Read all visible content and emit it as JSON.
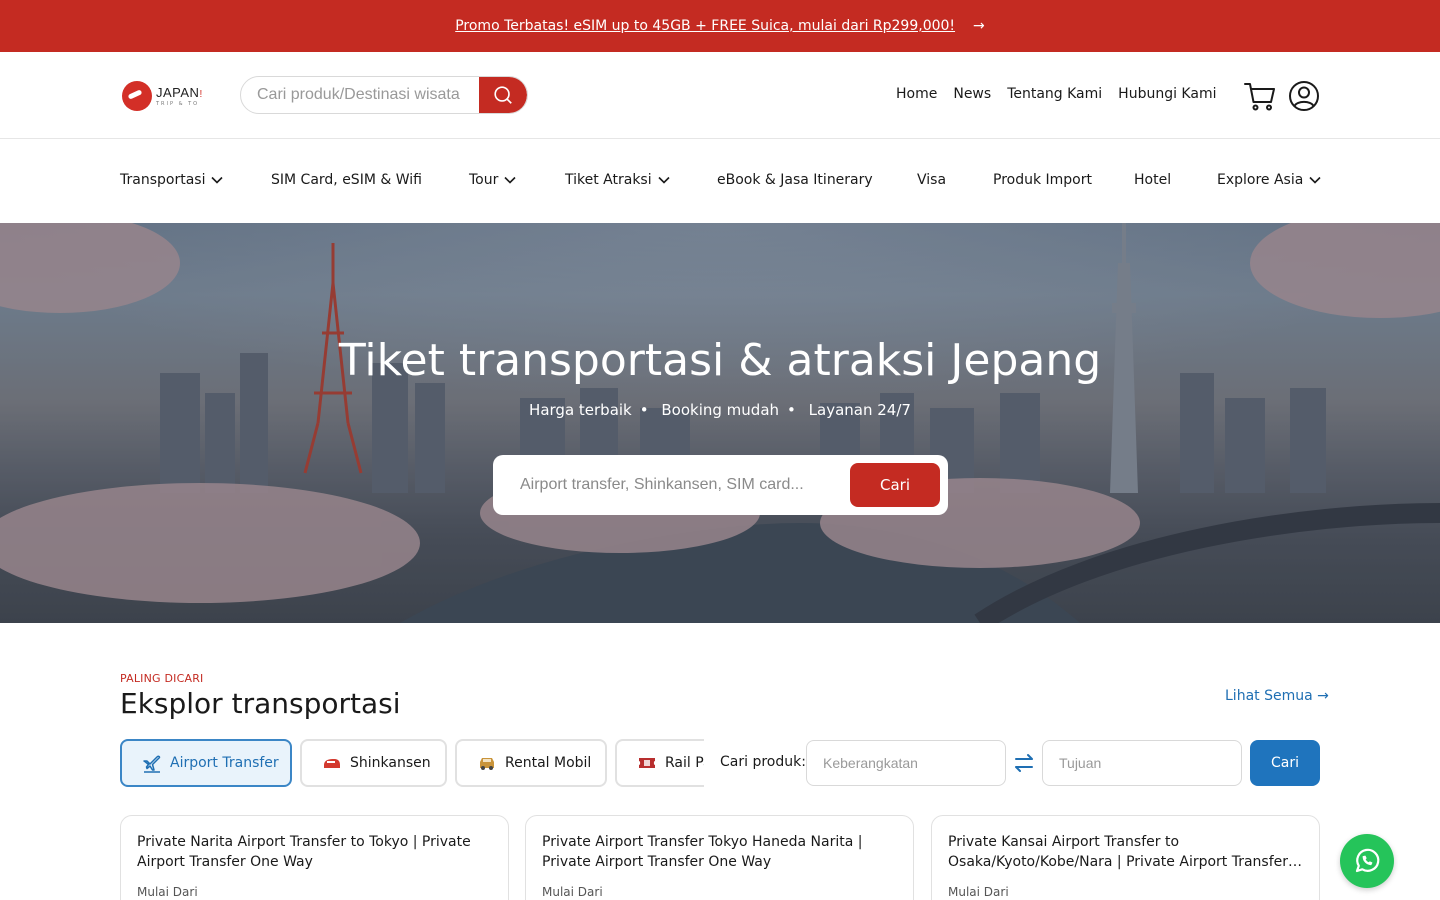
{
  "promo": {
    "text": "Promo Terbatas! eSIM up to 45GB + FREE Suica, mulai dari Rp299,000!",
    "arrow": "→"
  },
  "header": {
    "logo": {
      "brand": "JAPAN",
      "brand_suffix": "!",
      "tagline": "TRIP & TO"
    },
    "search": {
      "placeholder": "Cari produk/Destinasi wisata"
    },
    "nav": [
      "Home",
      "News",
      "Tentang Kami",
      "Hubungi Kami"
    ]
  },
  "categories": [
    {
      "label": "Transportasi",
      "dropdown": true
    },
    {
      "label": "SIM Card, eSIM & Wifi",
      "dropdown": false
    },
    {
      "label": "Tour",
      "dropdown": true
    },
    {
      "label": "Tiket Atraksi",
      "dropdown": true
    },
    {
      "label": "eBook & Jasa Itinerary",
      "dropdown": false
    },
    {
      "label": "Visa",
      "dropdown": false
    },
    {
      "label": "Produk Import",
      "dropdown": false
    },
    {
      "label": "Hotel",
      "dropdown": false
    },
    {
      "label": "Explore Asia",
      "dropdown": true
    }
  ],
  "hero": {
    "title": "Tiket transportasi & atraksi Jepang",
    "features": [
      "Harga terbaik",
      "Booking mudah",
      "Layanan 24/7"
    ],
    "search_placeholder": "Airport transfer, Shinkansen, SIM card...",
    "search_button": "Cari"
  },
  "section": {
    "eyebrow": "PALING DICARI",
    "title": "Eksplor transportasi",
    "see_all": "Lihat Semua →",
    "tabs": [
      {
        "label": "Airport Transfer",
        "icon": "plane-icon",
        "active": true
      },
      {
        "label": "Shinkansen",
        "icon": "train-icon",
        "active": false
      },
      {
        "label": "Rental Mobil",
        "icon": "car-icon",
        "active": false
      },
      {
        "label": "Rail Pass",
        "icon": "ticket-icon",
        "active": false
      }
    ],
    "finder": {
      "label": "Cari produk:",
      "from_placeholder": "Keberangkatan",
      "to_placeholder": "Tujuan",
      "button": "Cari"
    },
    "cards": [
      {
        "title": "Private Narita Airport Transfer to Tokyo | Private Airport Transfer One Way",
        "price_label": "Mulai Dari"
      },
      {
        "title": "Private Airport Transfer Tokyo Haneda Narita | Private Airport Transfer One Way",
        "price_label": "Mulai Dari"
      },
      {
        "title": "Private Kansai Airport Transfer to Osaka/Kyoto/Kobe/Nara | Private Airport Transfer One Way",
        "price_label": "Mulai Dari"
      }
    ]
  },
  "colors": {
    "brand_red": "#c42b22",
    "link_blue": "#1f6fb3",
    "whatsapp_green": "#25c45a"
  }
}
